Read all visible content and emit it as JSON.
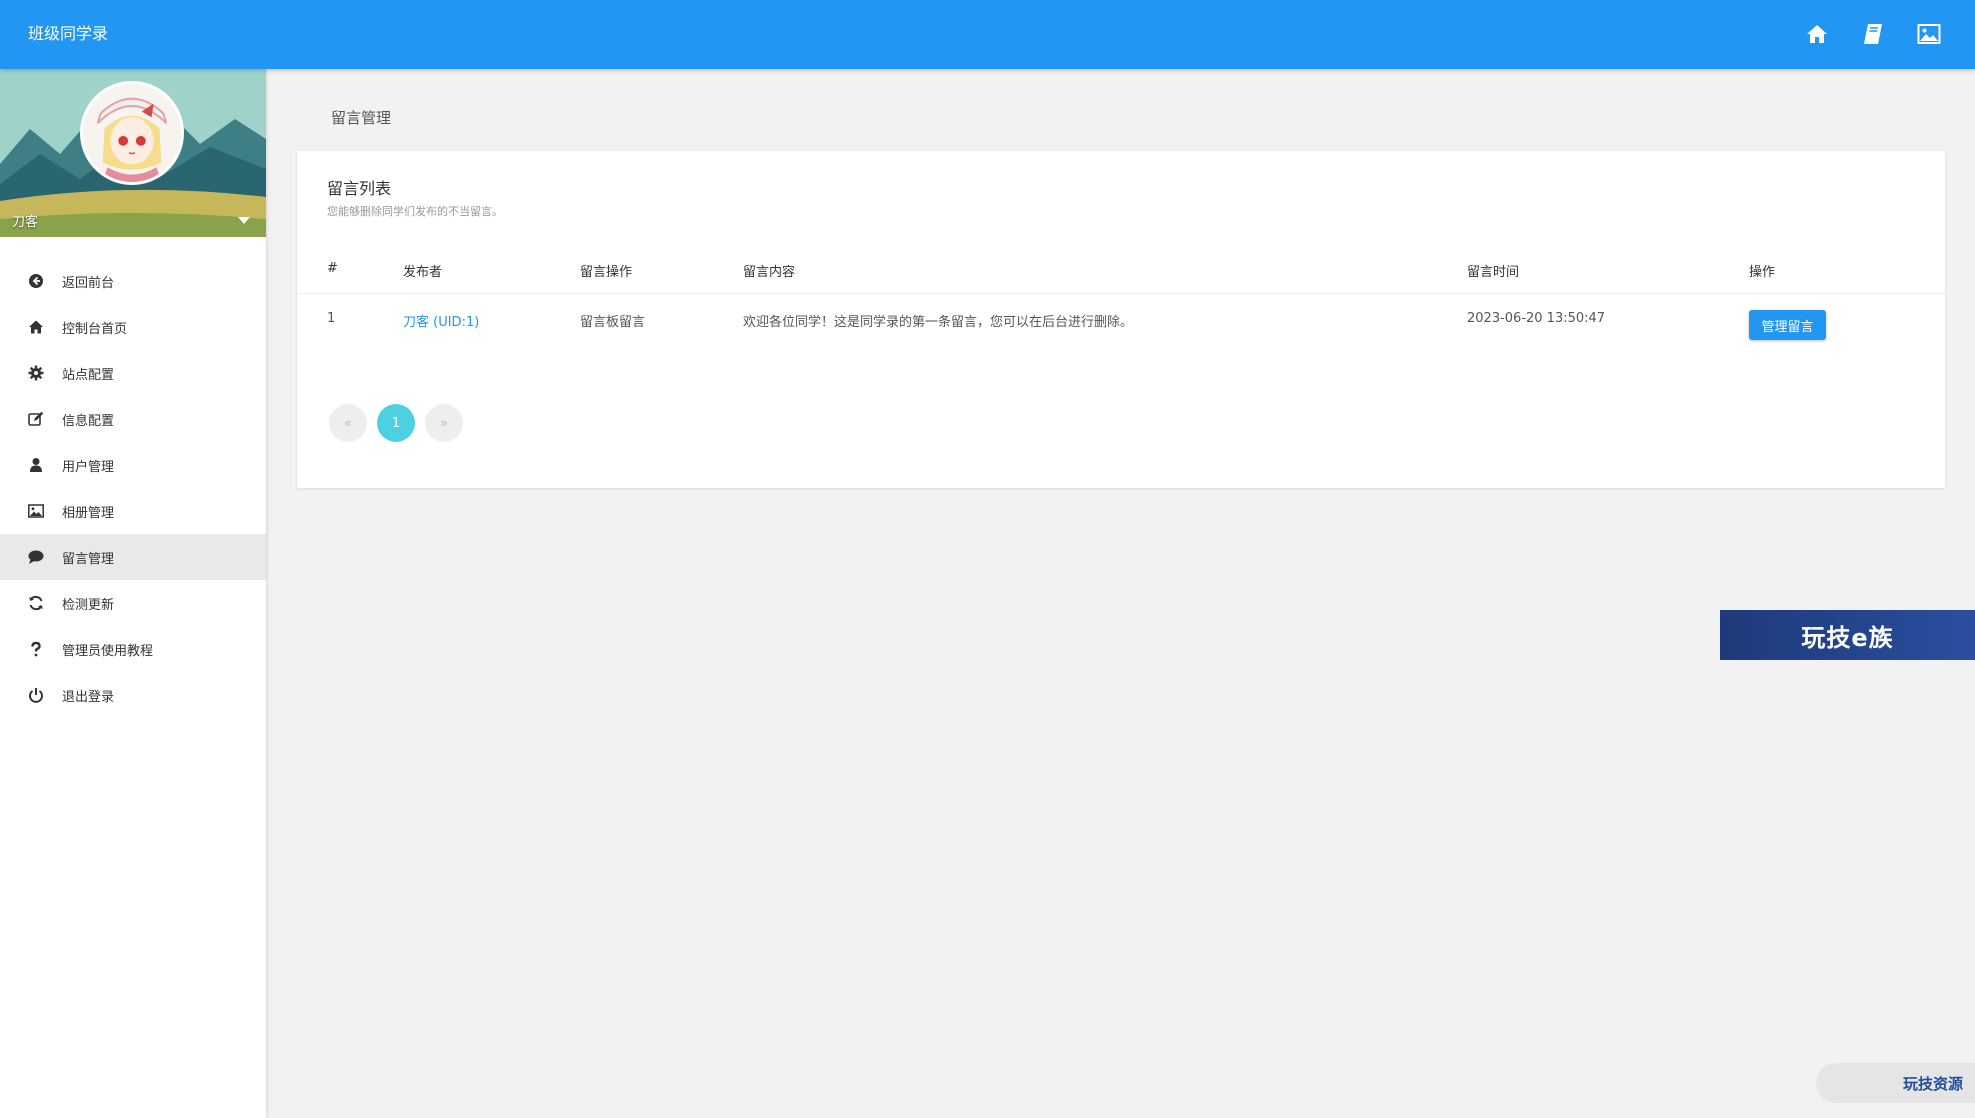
{
  "app": {
    "title": "班级同学录"
  },
  "header": {
    "icons": [
      "home-icon",
      "book-icon",
      "image-icon"
    ]
  },
  "profile": {
    "name": "刀客"
  },
  "sidebar": {
    "items": [
      {
        "label": "返回前台",
        "icon": "arrow-circle-left-icon"
      },
      {
        "label": "控制台首页",
        "icon": "home-icon"
      },
      {
        "label": "站点配置",
        "icon": "gear-icon"
      },
      {
        "label": "信息配置",
        "icon": "edit-icon"
      },
      {
        "label": "用户管理",
        "icon": "user-icon"
      },
      {
        "label": "相册管理",
        "icon": "image-icon"
      },
      {
        "label": "留言管理",
        "icon": "comment-icon",
        "active": true
      },
      {
        "label": "检测更新",
        "icon": "refresh-icon"
      },
      {
        "label": "管理员使用教程",
        "icon": "question-icon"
      },
      {
        "label": "退出登录",
        "icon": "power-icon"
      }
    ]
  },
  "page": {
    "title": "留言管理"
  },
  "card": {
    "title": "留言列表",
    "subtitle": "您能够删除同学们发布的不当留言。"
  },
  "table": {
    "headers": [
      "#",
      "发布者",
      "留言操作",
      "留言内容",
      "留言时间",
      "操作"
    ],
    "rows": [
      {
        "id": "1",
        "author": "刀客 (UID:1)",
        "type": "留言板留言",
        "content": "欢迎各位同学！这是同学录的第一条留言，您可以在后台进行删除。",
        "time": "2023-06-20 13:50:47",
        "action": "管理留言"
      }
    ]
  },
  "pagination": {
    "prev": "«",
    "current": "1",
    "next": "»"
  },
  "watermarks": {
    "banner": "玩技e族",
    "pill": "玩技资源"
  },
  "colors": {
    "primary": "#2196f3",
    "page_active": "#4dd0e1"
  }
}
